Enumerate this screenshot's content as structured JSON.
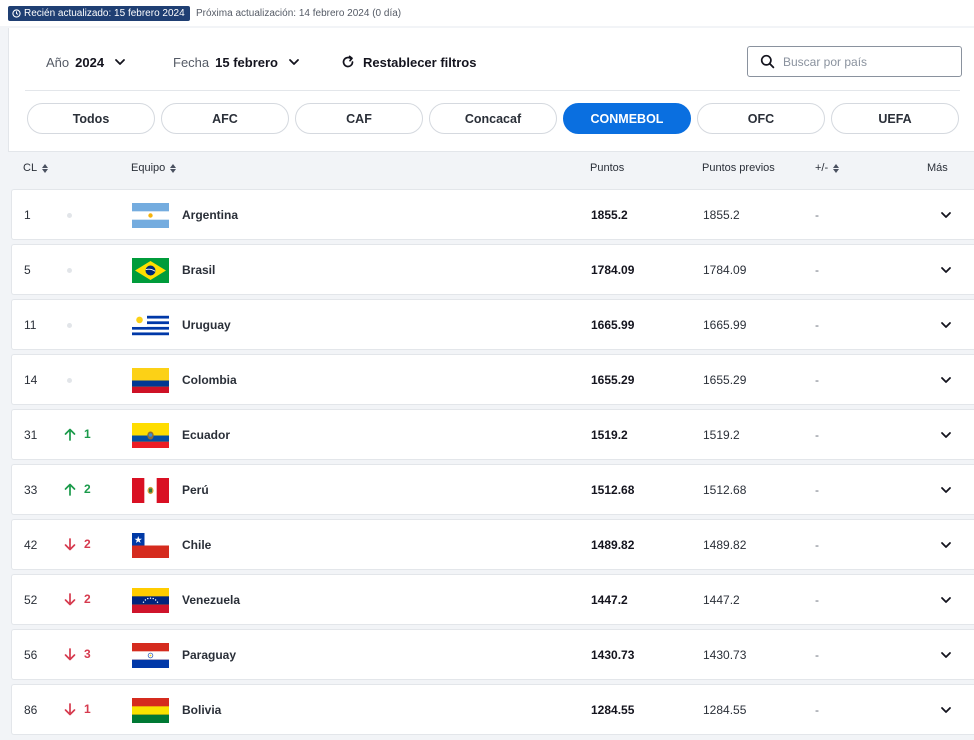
{
  "topbar": {
    "updated_badge": "Recién actualizado: 15 febrero 2024",
    "next_update": "Próxima actualización: 14 febrero 2024 (0 día)"
  },
  "filters": {
    "year_label": "Año",
    "year_value": "2024",
    "date_label": "Fecha",
    "date_value": "15 febrero",
    "reset_label": "Restablecer filtros",
    "search_placeholder": "Buscar por país"
  },
  "tabs": [
    {
      "label": "Todos",
      "active": false
    },
    {
      "label": "AFC",
      "active": false
    },
    {
      "label": "CAF",
      "active": false
    },
    {
      "label": "Concacaf",
      "active": false
    },
    {
      "label": "CONMEBOL",
      "active": true
    },
    {
      "label": "OFC",
      "active": false
    },
    {
      "label": "UEFA",
      "active": false
    }
  ],
  "columns": {
    "rank": "CL",
    "team": "Equipo",
    "points": "Puntos",
    "prev_points": "Puntos previos",
    "diff": "+/-",
    "more": "Más"
  },
  "colors": {
    "accent": "#0a6fe0",
    "badge": "#1f3f73",
    "up": "#1a9a4a",
    "down": "#d63a4e"
  },
  "rows": [
    {
      "rank": "1",
      "move": "none",
      "move_value": "",
      "team": "Argentina",
      "flag": "argentina",
      "points": "1855.2",
      "prev_points": "1855.2",
      "diff": "-"
    },
    {
      "rank": "5",
      "move": "none",
      "move_value": "",
      "team": "Brasil",
      "flag": "brasil",
      "points": "1784.09",
      "prev_points": "1784.09",
      "diff": "-"
    },
    {
      "rank": "11",
      "move": "none",
      "move_value": "",
      "team": "Uruguay",
      "flag": "uruguay",
      "points": "1665.99",
      "prev_points": "1665.99",
      "diff": "-"
    },
    {
      "rank": "14",
      "move": "none",
      "move_value": "",
      "team": "Colombia",
      "flag": "colombia",
      "points": "1655.29",
      "prev_points": "1655.29",
      "diff": "-"
    },
    {
      "rank": "31",
      "move": "up",
      "move_value": "1",
      "team": "Ecuador",
      "flag": "ecuador",
      "points": "1519.2",
      "prev_points": "1519.2",
      "diff": "-"
    },
    {
      "rank": "33",
      "move": "up",
      "move_value": "2",
      "team": "Perú",
      "flag": "peru",
      "points": "1512.68",
      "prev_points": "1512.68",
      "diff": "-"
    },
    {
      "rank": "42",
      "move": "down",
      "move_value": "2",
      "team": "Chile",
      "flag": "chile",
      "points": "1489.82",
      "prev_points": "1489.82",
      "diff": "-"
    },
    {
      "rank": "52",
      "move": "down",
      "move_value": "2",
      "team": "Venezuela",
      "flag": "venezuela",
      "points": "1447.2",
      "prev_points": "1447.2",
      "diff": "-"
    },
    {
      "rank": "56",
      "move": "down",
      "move_value": "3",
      "team": "Paraguay",
      "flag": "paraguay",
      "points": "1430.73",
      "prev_points": "1430.73",
      "diff": "-"
    },
    {
      "rank": "86",
      "move": "down",
      "move_value": "1",
      "team": "Bolivia",
      "flag": "bolivia",
      "points": "1284.55",
      "prev_points": "1284.55",
      "diff": "-"
    }
  ]
}
